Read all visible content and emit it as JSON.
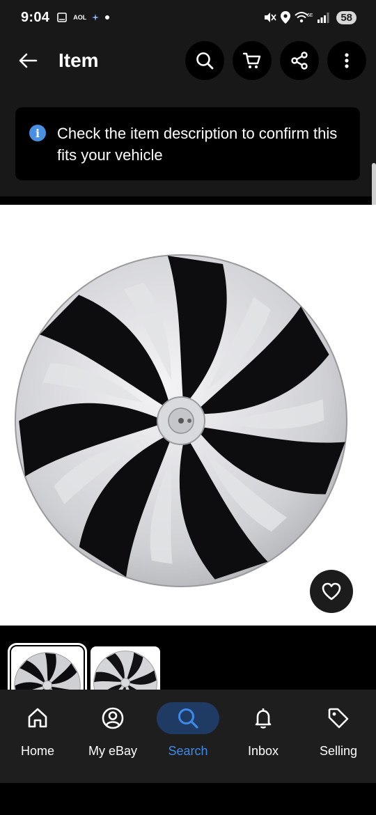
{
  "status_bar": {
    "time": "9:04",
    "aol": "AOL",
    "wifi_label": "6E",
    "battery": "58"
  },
  "header": {
    "title": "Item",
    "actions": [
      "search-icon",
      "cart-icon",
      "share-icon",
      "more-icon"
    ]
  },
  "notice": {
    "text": "Check the item description to confirm this fits your vehicle",
    "icon": "info-icon",
    "accent": "#4a90e2"
  },
  "gallery": {
    "favorite_icon": "heart-icon",
    "thumbnail_count": 2,
    "selected_thumbnail": 1
  },
  "bottom_nav": {
    "items": [
      {
        "label": "Home",
        "icon": "home-icon"
      },
      {
        "label": "My eBay",
        "icon": "user-icon"
      },
      {
        "label": "Search",
        "icon": "search-icon"
      },
      {
        "label": "Inbox",
        "icon": "bell-icon"
      },
      {
        "label": "Selling",
        "icon": "tag-icon"
      }
    ],
    "active": "Search",
    "active_color": "#3b8beb"
  }
}
